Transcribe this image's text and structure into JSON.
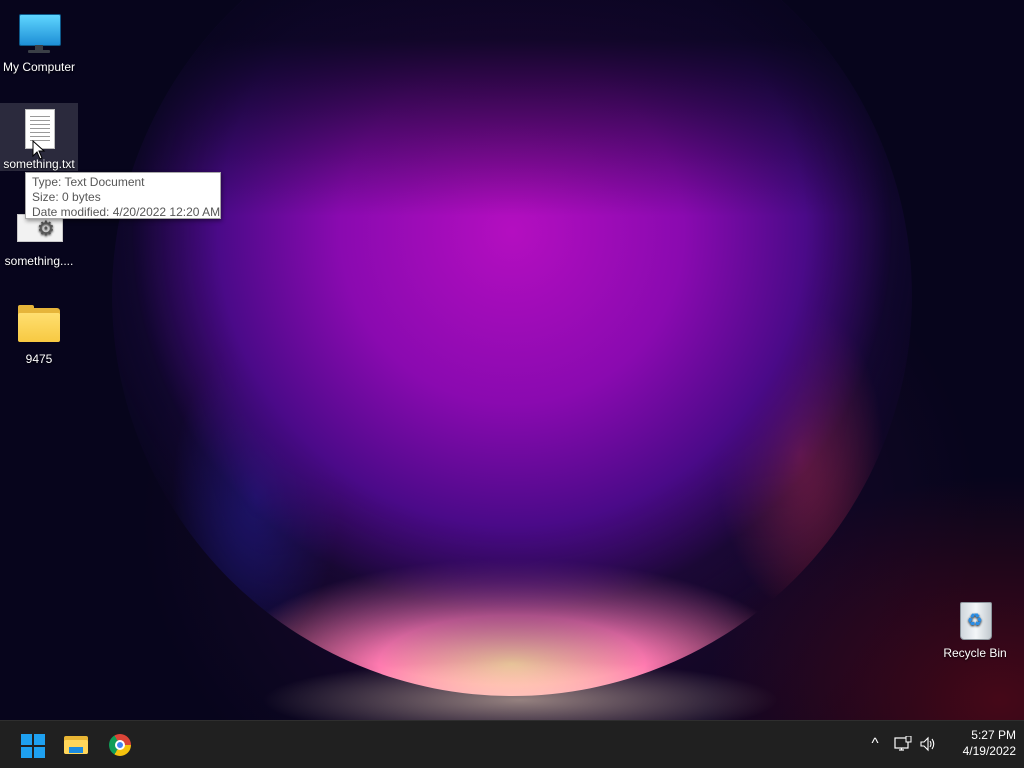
{
  "desktop": {
    "icons": [
      {
        "label": "My Computer",
        "icon": "monitor-icon"
      },
      {
        "label": "something.txt",
        "icon": "text-document-icon"
      },
      {
        "label": "something....",
        "icon": "settings-file-icon"
      },
      {
        "label": "9475",
        "icon": "folder-icon"
      },
      {
        "label": "Recycle Bin",
        "icon": "recycle-bin-icon"
      }
    ],
    "tooltip": {
      "type": "Type: Text Document",
      "size": "Size: 0 bytes",
      "modified": "Date modified: 4/20/2022 12:20 AM"
    }
  },
  "taskbar": {
    "pinned": [
      {
        "name": "Start",
        "icon": "windows-start-icon"
      },
      {
        "name": "File Explorer",
        "icon": "file-explorer-icon"
      },
      {
        "name": "Google Chrome",
        "icon": "chrome-icon"
      }
    ],
    "tray": {
      "chevron_glyph": "^",
      "network_icon": "network-icon",
      "volume_icon": "volume-icon"
    },
    "clock": {
      "time": "5:27 PM",
      "date": "4/19/2022"
    }
  },
  "colors": {
    "taskbar_bg": "#202020",
    "start_blue": "#1ea0f0",
    "wallpaper_base": "#07051c"
  }
}
